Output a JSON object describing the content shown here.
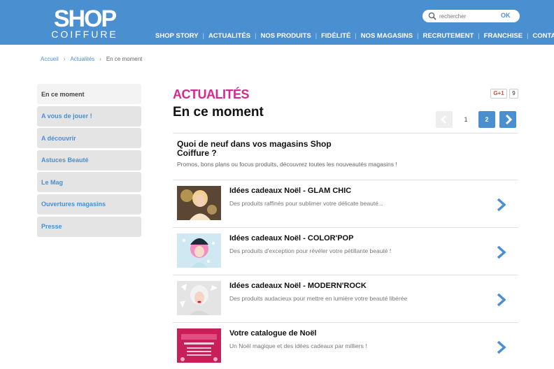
{
  "header": {
    "logo_top": "SHOP",
    "logo_bottom": "COIFFURE",
    "search": {
      "placeholder": "rechercher",
      "value": "",
      "submit_label": "OK"
    },
    "nav": [
      "SHOP STORY",
      "ACTUALITÉS",
      "NOS PRODUITS",
      "FIDÉLITÉ",
      "NOS MAGASINS",
      "RECRUTEMENT",
      "FRANCHISE",
      "CONTACT"
    ]
  },
  "breadcrumb": {
    "items": [
      "Accueil",
      "Actualités",
      "En ce moment"
    ]
  },
  "sidebar": {
    "items": [
      {
        "label": "En ce moment",
        "active": true
      },
      {
        "label": "A vous de jouer !",
        "active": false
      },
      {
        "label": "A découvrir",
        "active": false
      },
      {
        "label": "Astuces Beauté",
        "active": false
      },
      {
        "label": "Le Mag",
        "active": false
      },
      {
        "label": "Ouvertures magasins",
        "active": false
      },
      {
        "label": "Presse",
        "active": false
      }
    ]
  },
  "main": {
    "section_label": "ACTUALITÉS",
    "title": "En ce moment",
    "social": {
      "gplus_label": "G+1",
      "gplus_count": "9"
    },
    "pagination": {
      "pages": [
        "1",
        "2"
      ],
      "current": "2"
    },
    "intro": {
      "title": "Quoi de neuf dans vos magasins Shop Coiffure ?",
      "description": "Promos, bons plans ou focus produits, découvrez toutes les nouveautés magasins !"
    },
    "articles": [
      {
        "title": "Idées cadeaux Noël - GLAM CHIC",
        "description": "Des produits raffinés pour sublimer votre délicate beauté..."
      },
      {
        "title": "Idées cadeaux Noël - COLOR'POP",
        "description": "Des produits d'exception pour révéler votre pétillante beauté !"
      },
      {
        "title": "Idées cadeaux Noël - MODERN'ROCK",
        "description": "Des produits audacieux pour mettre en lumière votre beauté libérée"
      },
      {
        "title": "Votre catalogue de Noël",
        "description": "Un Noël magique et des idées cadeaux par milliers !"
      }
    ]
  },
  "colors": {
    "brand_blue": "#4a8fd0",
    "accent_pink": "#d42a8c"
  }
}
